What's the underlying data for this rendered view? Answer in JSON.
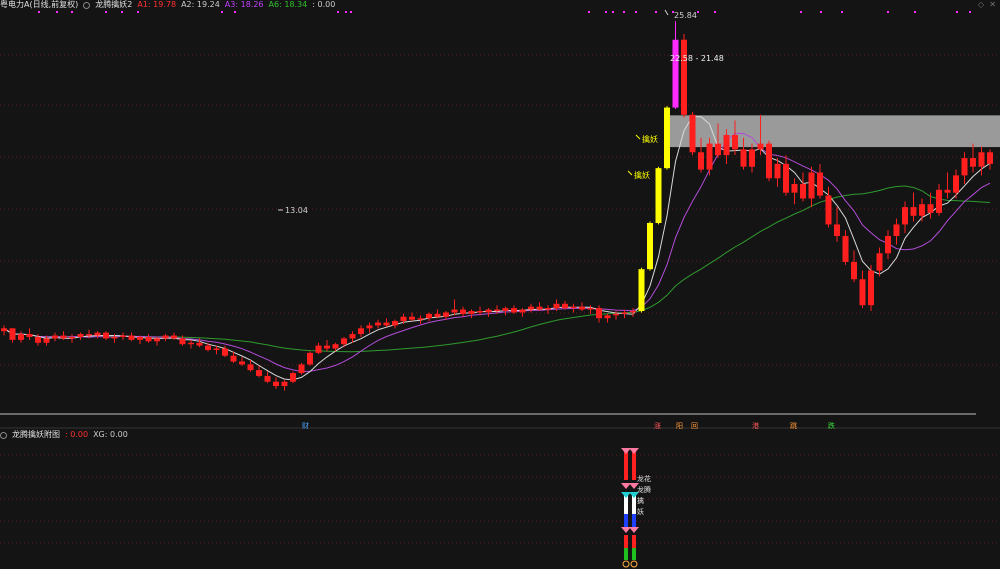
{
  "main_header": {
    "stock_title": "粤电力A(日线,前复权)",
    "indicator_name": "龙腾擒妖2",
    "a1_label": "A1:",
    "a1_value": "19.78",
    "a2_label": "A2:",
    "a2_value": "19.24",
    "a3_label": "A3:",
    "a3_value": "18.26",
    "a6_label": "A6:",
    "a6_value": "18.34",
    "extra_value": ": 0.00"
  },
  "sub_header": {
    "indicator_name": "龙腾擒妖附图",
    "value1": ": 0.00",
    "xg_label": "XG:",
    "xg_value": "0.00"
  },
  "annotations": {
    "high_label": "25.84",
    "low_label": "13.04",
    "range_label": "22.58 - 21.48",
    "signal_1": "擒妖",
    "signal_2": "擒妖",
    "sub_text": [
      "龙花",
      "龙腾",
      "擒",
      "妖"
    ]
  },
  "markers": {
    "cai": "财",
    "zhang": "涨",
    "yang": "阳",
    "hui": "回",
    "gang": "港",
    "diao": "跳",
    "die": "跌"
  },
  "colors": {
    "up": "#ff1f1f",
    "yellow": "#ffff00",
    "magenta": "#ff2bff",
    "ma_white": "#d9d9d9",
    "ma_purple": "#b44cd9",
    "ma_green": "#2f9a2f",
    "a1": "#ff3030",
    "a2": "#cccccc",
    "a3": "#c040ff",
    "a6": "#30c030",
    "sub_value": "#ff3030",
    "grid": "#5a1a1a"
  },
  "chart_data": {
    "type": "candlestick",
    "price_range": [
      12.3,
      26.3
    ],
    "key_points": {
      "high": 25.84,
      "low": 13.04
    },
    "candles": [
      [
        15.1,
        15.3,
        14.95,
        15.2
      ],
      [
        15.2,
        15.2,
        14.7,
        14.8
      ],
      [
        14.8,
        15.1,
        14.7,
        15.0
      ],
      [
        15.0,
        15.2,
        14.8,
        14.9
      ],
      [
        14.9,
        15.0,
        14.6,
        14.7
      ],
      [
        14.7,
        14.95,
        14.6,
        14.85
      ],
      [
        14.85,
        15.05,
        14.75,
        14.95
      ],
      [
        14.95,
        15.1,
        14.8,
        14.85
      ],
      [
        14.85,
        15.0,
        14.7,
        14.9
      ],
      [
        14.9,
        15.05,
        14.8,
        15.0
      ],
      [
        15.0,
        15.15,
        14.85,
        14.95
      ],
      [
        14.95,
        15.1,
        14.85,
        15.05
      ],
      [
        15.05,
        15.1,
        14.8,
        14.85
      ],
      [
        14.85,
        15.0,
        14.7,
        14.9
      ],
      [
        14.9,
        15.05,
        14.8,
        14.95
      ],
      [
        14.95,
        15.05,
        14.75,
        14.8
      ],
      [
        14.8,
        14.95,
        14.65,
        14.9
      ],
      [
        14.9,
        15.0,
        14.7,
        14.75
      ],
      [
        14.75,
        14.9,
        14.6,
        14.85
      ],
      [
        14.85,
        15.0,
        14.75,
        14.95
      ],
      [
        14.95,
        15.05,
        14.8,
        14.85
      ],
      [
        14.85,
        14.95,
        14.6,
        14.65
      ],
      [
        14.65,
        14.8,
        14.5,
        14.7
      ],
      [
        14.7,
        14.85,
        14.55,
        14.6
      ],
      [
        14.6,
        14.7,
        14.4,
        14.45
      ],
      [
        14.45,
        14.6,
        14.3,
        14.5
      ],
      [
        14.5,
        14.6,
        14.2,
        14.25
      ],
      [
        14.25,
        14.4,
        14.0,
        14.05
      ],
      [
        14.05,
        14.2,
        13.9,
        13.95
      ],
      [
        13.95,
        14.1,
        13.7,
        13.75
      ],
      [
        13.75,
        13.9,
        13.5,
        13.55
      ],
      [
        13.55,
        13.7,
        13.3,
        13.35
      ],
      [
        13.35,
        13.5,
        13.1,
        13.2
      ],
      [
        13.2,
        13.4,
        13.04,
        13.35
      ],
      [
        13.35,
        13.7,
        13.3,
        13.65
      ],
      [
        13.65,
        14.0,
        13.6,
        13.95
      ],
      [
        13.95,
        14.4,
        13.9,
        14.35
      ],
      [
        14.35,
        14.7,
        14.3,
        14.6
      ],
      [
        14.6,
        14.8,
        14.4,
        14.5
      ],
      [
        14.5,
        14.7,
        14.4,
        14.65
      ],
      [
        14.65,
        14.9,
        14.55,
        14.85
      ],
      [
        14.85,
        15.1,
        14.7,
        15.0
      ],
      [
        15.0,
        15.3,
        14.9,
        15.2
      ],
      [
        15.2,
        15.4,
        15.05,
        15.3
      ],
      [
        15.3,
        15.5,
        15.2,
        15.4
      ],
      [
        15.4,
        15.55,
        15.25,
        15.3
      ],
      [
        15.3,
        15.5,
        15.2,
        15.45
      ],
      [
        15.45,
        15.7,
        15.35,
        15.6
      ],
      [
        15.6,
        15.75,
        15.45,
        15.5
      ],
      [
        15.5,
        15.65,
        15.35,
        15.55
      ],
      [
        15.55,
        15.75,
        15.45,
        15.7
      ],
      [
        15.7,
        15.85,
        15.55,
        15.6
      ],
      [
        15.6,
        15.8,
        15.5,
        15.75
      ],
      [
        15.75,
        16.2,
        15.65,
        15.85
      ],
      [
        15.85,
        15.95,
        15.6,
        15.7
      ],
      [
        15.7,
        15.85,
        15.55,
        15.8
      ],
      [
        15.8,
        15.95,
        15.65,
        15.75
      ],
      [
        15.75,
        15.9,
        15.6,
        15.85
      ],
      [
        15.85,
        16.0,
        15.7,
        15.8
      ],
      [
        15.8,
        15.95,
        15.65,
        15.9
      ],
      [
        15.9,
        16.0,
        15.7,
        15.75
      ],
      [
        15.75,
        15.9,
        15.6,
        15.85
      ],
      [
        15.85,
        16.05,
        15.75,
        15.95
      ],
      [
        15.95,
        16.1,
        15.8,
        15.85
      ],
      [
        15.85,
        16.0,
        15.7,
        15.9
      ],
      [
        15.9,
        16.2,
        15.8,
        16.05
      ],
      [
        16.05,
        16.15,
        15.85,
        15.9
      ],
      [
        15.9,
        16.05,
        15.75,
        15.95
      ],
      [
        15.95,
        16.1,
        15.8,
        15.85
      ],
      [
        15.85,
        16.0,
        15.7,
        15.9
      ],
      [
        15.9,
        16.0,
        15.4,
        15.55
      ],
      [
        15.55,
        15.7,
        15.4,
        15.65
      ],
      [
        15.65,
        15.8,
        15.5,
        15.7
      ],
      [
        15.7,
        15.85,
        15.55,
        15.75
      ],
      [
        15.75,
        15.9,
        15.6,
        15.8
      ],
      [
        15.8,
        17.3,
        15.75,
        17.25
      ],
      [
        17.25,
        18.9,
        17.2,
        18.85
      ],
      [
        18.85,
        20.8,
        18.8,
        20.75
      ],
      [
        20.75,
        22.9,
        20.7,
        22.85
      ],
      [
        22.85,
        25.84,
        22.8,
        25.2
      ],
      [
        25.2,
        25.4,
        22.5,
        22.6
      ],
      [
        22.6,
        22.7,
        21.2,
        21.3
      ],
      [
        21.3,
        21.8,
        20.6,
        20.7
      ],
      [
        20.7,
        21.8,
        20.5,
        21.6
      ],
      [
        21.6,
        22.3,
        21.1,
        21.2
      ],
      [
        21.2,
        22.1,
        20.9,
        21.9
      ],
      [
        21.9,
        22.4,
        21.2,
        21.4
      ],
      [
        21.4,
        21.8,
        20.7,
        20.8
      ],
      [
        20.8,
        21.6,
        20.6,
        21.4
      ],
      [
        21.4,
        22.6,
        21.2,
        21.6
      ],
      [
        21.6,
        21.7,
        20.3,
        20.4
      ],
      [
        20.4,
        21.1,
        20.1,
        20.9
      ],
      [
        20.9,
        21.2,
        19.8,
        19.9
      ],
      [
        19.9,
        20.4,
        19.5,
        20.2
      ],
      [
        20.2,
        20.6,
        19.6,
        19.7
      ],
      [
        19.7,
        20.8,
        19.4,
        20.6
      ],
      [
        20.6,
        20.9,
        19.7,
        19.8
      ],
      [
        19.8,
        20.1,
        18.7,
        18.8
      ],
      [
        18.8,
        19.4,
        18.2,
        18.4
      ],
      [
        18.4,
        18.6,
        17.4,
        17.5
      ],
      [
        17.5,
        17.9,
        16.8,
        16.9
      ],
      [
        16.9,
        17.2,
        15.9,
        16.0
      ],
      [
        16.0,
        17.4,
        15.8,
        17.2
      ],
      [
        17.2,
        18.0,
        17.0,
        17.8
      ],
      [
        17.8,
        18.6,
        17.6,
        18.4
      ],
      [
        18.4,
        19.0,
        18.1,
        18.8
      ],
      [
        18.8,
        19.6,
        18.5,
        19.4
      ],
      [
        19.4,
        19.9,
        18.9,
        19.1
      ],
      [
        19.1,
        19.7,
        18.9,
        19.5
      ],
      [
        19.5,
        19.9,
        19.0,
        19.2
      ],
      [
        19.2,
        20.2,
        19.1,
        20.0
      ],
      [
        20.0,
        20.6,
        19.7,
        19.9
      ],
      [
        19.9,
        20.7,
        19.7,
        20.5
      ],
      [
        20.5,
        21.3,
        20.2,
        21.1
      ],
      [
        21.1,
        21.6,
        20.6,
        20.8
      ],
      [
        20.8,
        21.5,
        20.5,
        21.3
      ],
      [
        21.3,
        21.4,
        20.7,
        20.9
      ]
    ]
  }
}
